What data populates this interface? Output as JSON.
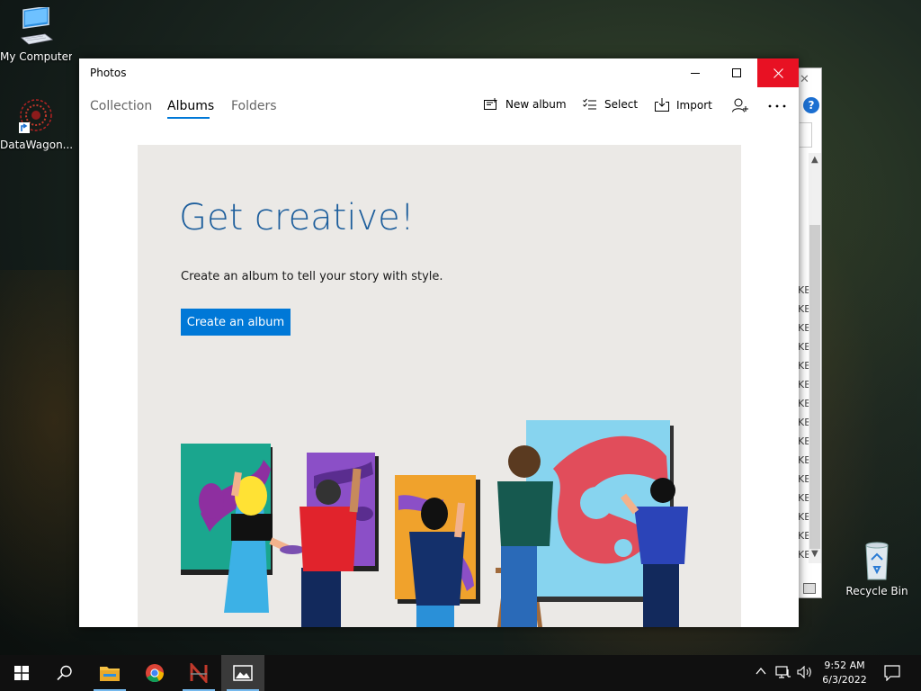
{
  "desktop": {
    "icons": [
      {
        "label": "My Computer"
      },
      {
        "label": "DataWagon..."
      },
      {
        "label": "Recycle Bin"
      }
    ]
  },
  "background_window": {
    "kb_label": "KB"
  },
  "photos": {
    "window_title": "Photos",
    "tabs": [
      {
        "label": "Collection"
      },
      {
        "label": "Albums"
      },
      {
        "label": "Folders"
      }
    ],
    "active_tab": "Albums",
    "toolbar": {
      "new_album": "New album",
      "select": "Select",
      "import": "Import"
    },
    "hero": {
      "title": "Get creative!",
      "subtitle": "Create an album to tell your story with style.",
      "button": "Create an album"
    }
  },
  "taskbar": {
    "time": "9:52 AM",
    "date": "6/3/2022"
  },
  "colors": {
    "accent": "#0078d7",
    "close_red": "#e81123",
    "hero_title": "#1d5e9c"
  }
}
